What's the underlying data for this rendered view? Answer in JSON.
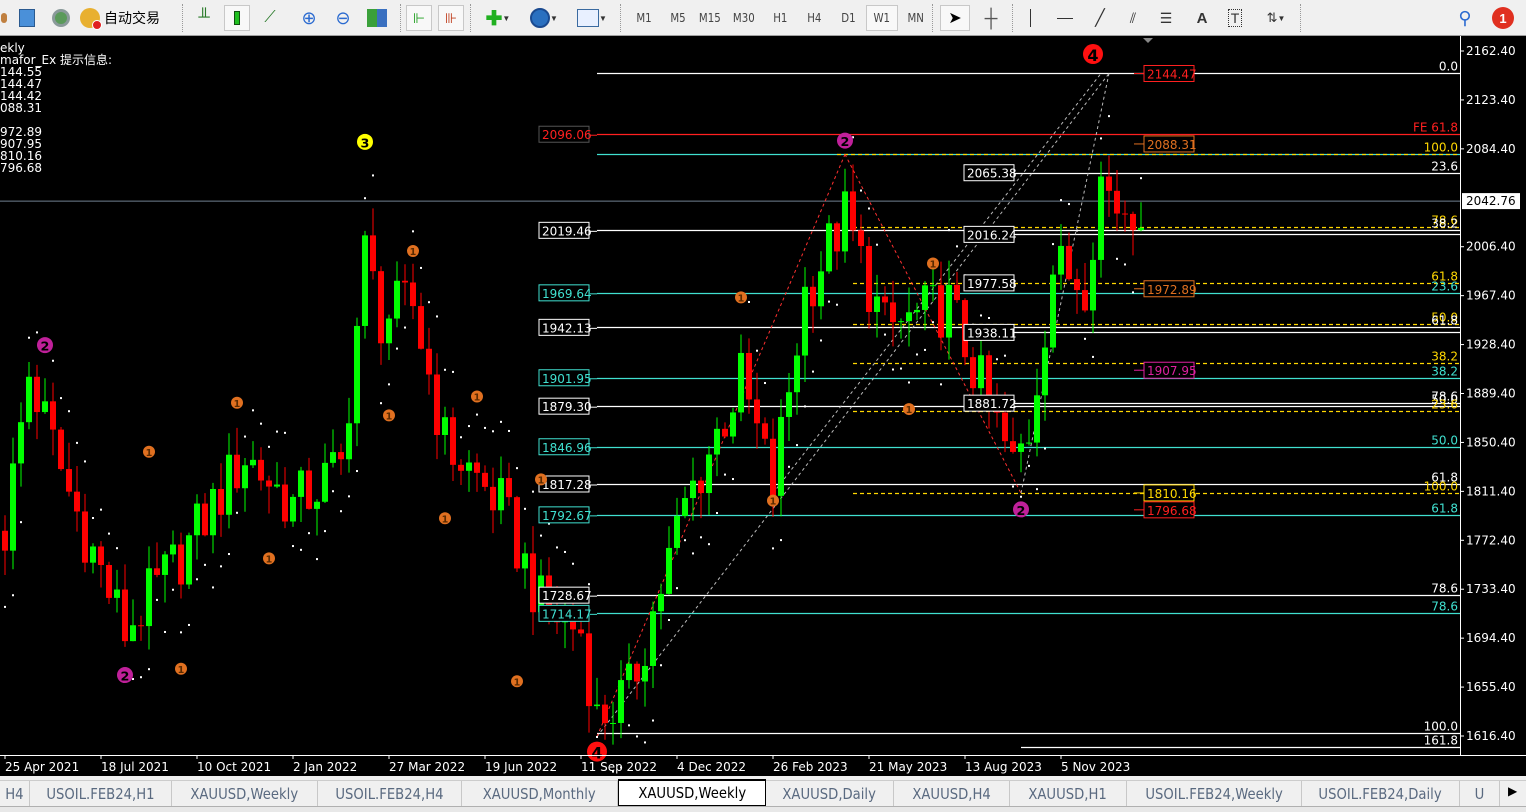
{
  "toolbar": {
    "auto_trade_label": "自动交易",
    "timeframes": [
      "M1",
      "M5",
      "M15",
      "M30",
      "H1",
      "H4",
      "D1",
      "W1",
      "MN"
    ],
    "active_timeframe": "W1",
    "notification_count": "1"
  },
  "info_panel": {
    "lines": [
      "ekly",
      "mafor_Ex 提示信息:",
      "144.55",
      "144.47",
      "144.42",
      "088.31",
      "",
      "972.89",
      "907.95",
      "810.16",
      "796.68"
    ]
  },
  "price_axis": {
    "ticks": [
      "2162.40",
      "2123.40",
      "2084.40",
      "2006.40",
      "1967.40",
      "1928.40",
      "1889.40",
      "1850.40",
      "1811.40",
      "1772.40",
      "1733.40",
      "1694.40",
      "1655.40",
      "1616.40"
    ],
    "tick_values": [
      2162.4,
      2123.4,
      2084.4,
      2006.4,
      1967.4,
      1928.4,
      1889.4,
      1850.4,
      1811.4,
      1772.4,
      1733.4,
      1694.4,
      1655.4,
      1616.4
    ],
    "current_price": "2042.76",
    "current_value": 2042.76
  },
  "time_axis": {
    "labels": [
      {
        "text": "25 Apr 2021",
        "week": 0
      },
      {
        "text": "18 Jul 2021",
        "week": 12
      },
      {
        "text": "10 Oct 2021",
        "week": 24
      },
      {
        "text": "2 Jan 2022",
        "week": 36
      },
      {
        "text": "27 Mar 2022",
        "week": 48
      },
      {
        "text": "19 Jun 2022",
        "week": 60
      },
      {
        "text": "11 Sep 2022",
        "week": 72
      },
      {
        "text": "4 Dec 2022",
        "week": 84
      },
      {
        "text": "26 Feb 2023",
        "week": 96
      },
      {
        "text": "21 May 2023",
        "week": 108
      },
      {
        "text": "13 Aug 2023",
        "week": 120
      },
      {
        "text": "5 Nov 2023",
        "week": 132
      }
    ]
  },
  "colors": {
    "bull": "#00ff00",
    "bear": "#ff0000",
    "white": "#ffffff",
    "cyan": "#40e0d0",
    "yellow": "#ffd700",
    "red": "#ff2020",
    "orange": "#e07020",
    "magenta": "#e020a0",
    "grid": "#708090"
  },
  "chart_data": {
    "type": "candlestick",
    "symbol": "XAUUSD",
    "timeframe": "Weekly",
    "price_path": [
      [
        0,
        1780
      ],
      [
        3,
        1905
      ],
      [
        8,
        1810
      ],
      [
        15,
        1700
      ],
      [
        22,
        1760
      ],
      [
        30,
        1840
      ],
      [
        36,
        1800
      ],
      [
        42,
        1830
      ],
      [
        45,
        2000
      ],
      [
        47,
        1950
      ],
      [
        51,
        1960
      ],
      [
        55,
        1850
      ],
      [
        62,
        1800
      ],
      [
        67,
        1720
      ],
      [
        72,
        1700
      ],
      [
        74,
        1630
      ],
      [
        78,
        1650
      ],
      [
        85,
        1800
      ],
      [
        92,
        1900
      ],
      [
        96,
        1815
      ],
      [
        100,
        1970
      ],
      [
        105,
        2030
      ],
      [
        110,
        1940
      ],
      [
        118,
        1960
      ],
      [
        122,
        1895
      ],
      [
        126,
        1830
      ],
      [
        128,
        1860
      ],
      [
        131,
        1990
      ],
      [
        135,
        1980
      ],
      [
        137,
        2060
      ],
      [
        139,
        2040
      ],
      [
        142,
        2042
      ]
    ],
    "levels": [
      {
        "price": 2144.47,
        "color": "white",
        "dash": false,
        "from": 74,
        "label": "0.0"
      },
      {
        "price": 2096.06,
        "color": "red",
        "dash": false,
        "from": 74,
        "label": "FE 61.8"
      },
      {
        "price": 2080.3,
        "color": "cyan",
        "dash": false,
        "from": 74,
        "label": ""
      },
      {
        "price": 2080.3,
        "color": "yellow",
        "dash": true,
        "from": 104,
        "label": "100.0"
      },
      {
        "price": 2065.38,
        "color": "white",
        "dash": false,
        "from": 120,
        "label": "23.6"
      },
      {
        "price": 2022.0,
        "color": "yellow",
        "dash": true,
        "from": 106,
        "label": "78.6"
      },
      {
        "price": 2019.46,
        "color": "white",
        "dash": false,
        "from": 74,
        "label": "38.2"
      },
      {
        "price": 2016.24,
        "color": "white",
        "dash": false,
        "from": 120,
        "label": ""
      },
      {
        "price": 1977.58,
        "color": "yellow",
        "dash": true,
        "from": 106,
        "label": "61.8"
      },
      {
        "price": 1969.64,
        "color": "cyan",
        "dash": false,
        "from": 74,
        "label": "23.6"
      },
      {
        "price": 1944.5,
        "color": "yellow",
        "dash": true,
        "from": 106,
        "label": "50.0"
      },
      {
        "price": 1942.13,
        "color": "white",
        "dash": false,
        "from": 74,
        "label": "61.8"
      },
      {
        "price": 1938.11,
        "color": "white",
        "dash": false,
        "from": 120,
        "label": ""
      },
      {
        "price": 1913.7,
        "color": "yellow",
        "dash": true,
        "from": 106,
        "label": "38.2"
      },
      {
        "price": 1901.95,
        "color": "cyan",
        "dash": false,
        "from": 74,
        "label": "38.2"
      },
      {
        "price": 1881.72,
        "color": "white",
        "dash": false,
        "from": 120,
        "label": "78.6"
      },
      {
        "price": 1879.3,
        "color": "white",
        "dash": false,
        "from": 74,
        "label": "50.0"
      },
      {
        "price": 1875.4,
        "color": "yellow",
        "dash": true,
        "from": 106,
        "label": "23.6"
      },
      {
        "price": 1846.96,
        "color": "cyan",
        "dash": false,
        "from": 74,
        "label": "50.0"
      },
      {
        "price": 1817.28,
        "color": "white",
        "dash": false,
        "from": 74,
        "label": "61.8"
      },
      {
        "price": 1810.16,
        "color": "yellow",
        "dash": true,
        "from": 106,
        "label": "100.0"
      },
      {
        "price": 1792.67,
        "color": "cyan",
        "dash": false,
        "from": 74,
        "label": "61.8"
      },
      {
        "price": 1728.67,
        "color": "white",
        "dash": false,
        "from": 74,
        "label": "78.6"
      },
      {
        "price": 1714.17,
        "color": "cyan",
        "dash": false,
        "from": 74,
        "label": "78.6"
      },
      {
        "price": 1618.8,
        "color": "white",
        "dash": false,
        "from": 74,
        "label": "100.0"
      },
      {
        "price": 1607.5,
        "color": "white",
        "dash": false,
        "from": 127,
        "label": "161.8"
      }
    ],
    "left_boxes": [
      {
        "text": "2096.06",
        "price": 2096.06,
        "color": "red"
      },
      {
        "text": "2019.46",
        "price": 2019.46,
        "color": "white"
      },
      {
        "text": "1969.64",
        "price": 1969.64,
        "color": "cyan"
      },
      {
        "text": "1942.13",
        "price": 1942.13,
        "color": "white"
      },
      {
        "text": "1901.95",
        "price": 1901.95,
        "color": "cyan"
      },
      {
        "text": "1879.30",
        "price": 1879.3,
        "color": "white"
      },
      {
        "text": "1846.96",
        "price": 1846.96,
        "color": "cyan"
      },
      {
        "text": "1817.28",
        "price": 1817.28,
        "color": "white"
      },
      {
        "text": "1792.67",
        "price": 1792.67,
        "color": "cyan"
      },
      {
        "text": "1728.67",
        "price": 1728.67,
        "color": "white"
      },
      {
        "text": "1714.17",
        "price": 1714.17,
        "color": "cyan"
      }
    ],
    "mid_boxes": [
      {
        "text": "2065.38",
        "price": 2065.38
      },
      {
        "text": "2016.24",
        "price": 2016.24
      },
      {
        "text": "1977.58",
        "price": 1977.58
      },
      {
        "text": "1938.11",
        "price": 1938.11
      },
      {
        "text": "1881.72",
        "price": 1881.72
      }
    ],
    "right_boxes": [
      {
        "text": "2144.47",
        "price": 2144.47,
        "color": "red"
      },
      {
        "text": "2088.31",
        "price": 2088.31,
        "color": "orange"
      },
      {
        "text": "1972.89",
        "price": 1972.89,
        "color": "orange"
      },
      {
        "text": "1907.95",
        "price": 1907.95,
        "color": "magenta"
      },
      {
        "text": "1810.16",
        "price": 1810.16,
        "color": "yellow"
      },
      {
        "text": "1796.68",
        "price": 1796.68,
        "color": "red"
      }
    ],
    "markers": [
      {
        "label": "2",
        "week": 5,
        "price": 1928,
        "color": "#c0209a"
      },
      {
        "label": "2",
        "week": 15,
        "price": 1665,
        "color": "#c0209a"
      },
      {
        "label": "3",
        "week": 45,
        "price": 2090,
        "color": "#ffff00"
      },
      {
        "label": "2",
        "week": 105,
        "price": 2091,
        "color": "#c0209a"
      },
      {
        "label": "2",
        "week": 127,
        "price": 1797,
        "color": "#c0209a"
      },
      {
        "label": "4",
        "week": 136,
        "price": 2160,
        "color": "#ff1010"
      },
      {
        "label": "4",
        "week": 74,
        "price": 1604,
        "color": "#ff1010"
      },
      {
        "label": "1",
        "week": 18,
        "price": 1843,
        "color": "#e07020"
      },
      {
        "label": "1",
        "week": 22,
        "price": 1670,
        "color": "#e07020"
      },
      {
        "label": "1",
        "week": 29,
        "price": 1882,
        "color": "#e07020"
      },
      {
        "label": "1",
        "week": 33,
        "price": 1758,
        "color": "#e07020"
      },
      {
        "label": "1",
        "week": 51,
        "price": 2003,
        "color": "#e07020"
      },
      {
        "label": "1",
        "week": 48,
        "price": 1872,
        "color": "#e07020"
      },
      {
        "label": "1",
        "week": 59,
        "price": 1887,
        "color": "#e07020"
      },
      {
        "label": "1",
        "week": 55,
        "price": 1790,
        "color": "#e07020"
      },
      {
        "label": "1",
        "week": 64,
        "price": 1660,
        "color": "#e07020"
      },
      {
        "label": "1",
        "week": 67,
        "price": 1821,
        "color": "#e07020"
      },
      {
        "label": "1",
        "week": 92,
        "price": 1966,
        "color": "#e07020"
      },
      {
        "label": "1",
        "week": 96,
        "price": 1804,
        "color": "#e07020"
      },
      {
        "label": "1",
        "week": 116,
        "price": 1993,
        "color": "#e07020"
      },
      {
        "label": "1",
        "week": 113,
        "price": 1877,
        "color": "#e07020"
      }
    ]
  },
  "tabs": [
    {
      "label": "H4",
      "w": 30
    },
    {
      "label": "USOIL.FEB24,H1",
      "w": 142
    },
    {
      "label": "XAUUSD,Weekly",
      "w": 146
    },
    {
      "label": "USOIL.FEB24,H4",
      "w": 144
    },
    {
      "label": "XAUUSD,Monthly",
      "w": 156
    },
    {
      "label": "XAUUSD,Weekly",
      "w": 148,
      "active": true
    },
    {
      "label": "XAUUSD,Daily",
      "w": 128
    },
    {
      "label": "XAUUSD,H4",
      "w": 116
    },
    {
      "label": "XAUUSD,H1",
      "w": 117
    },
    {
      "label": "USOIL.FEB24,Weekly",
      "w": 175
    },
    {
      "label": "USOIL.FEB24,Daily",
      "w": 158
    },
    {
      "label": "U",
      "w": 40
    }
  ]
}
